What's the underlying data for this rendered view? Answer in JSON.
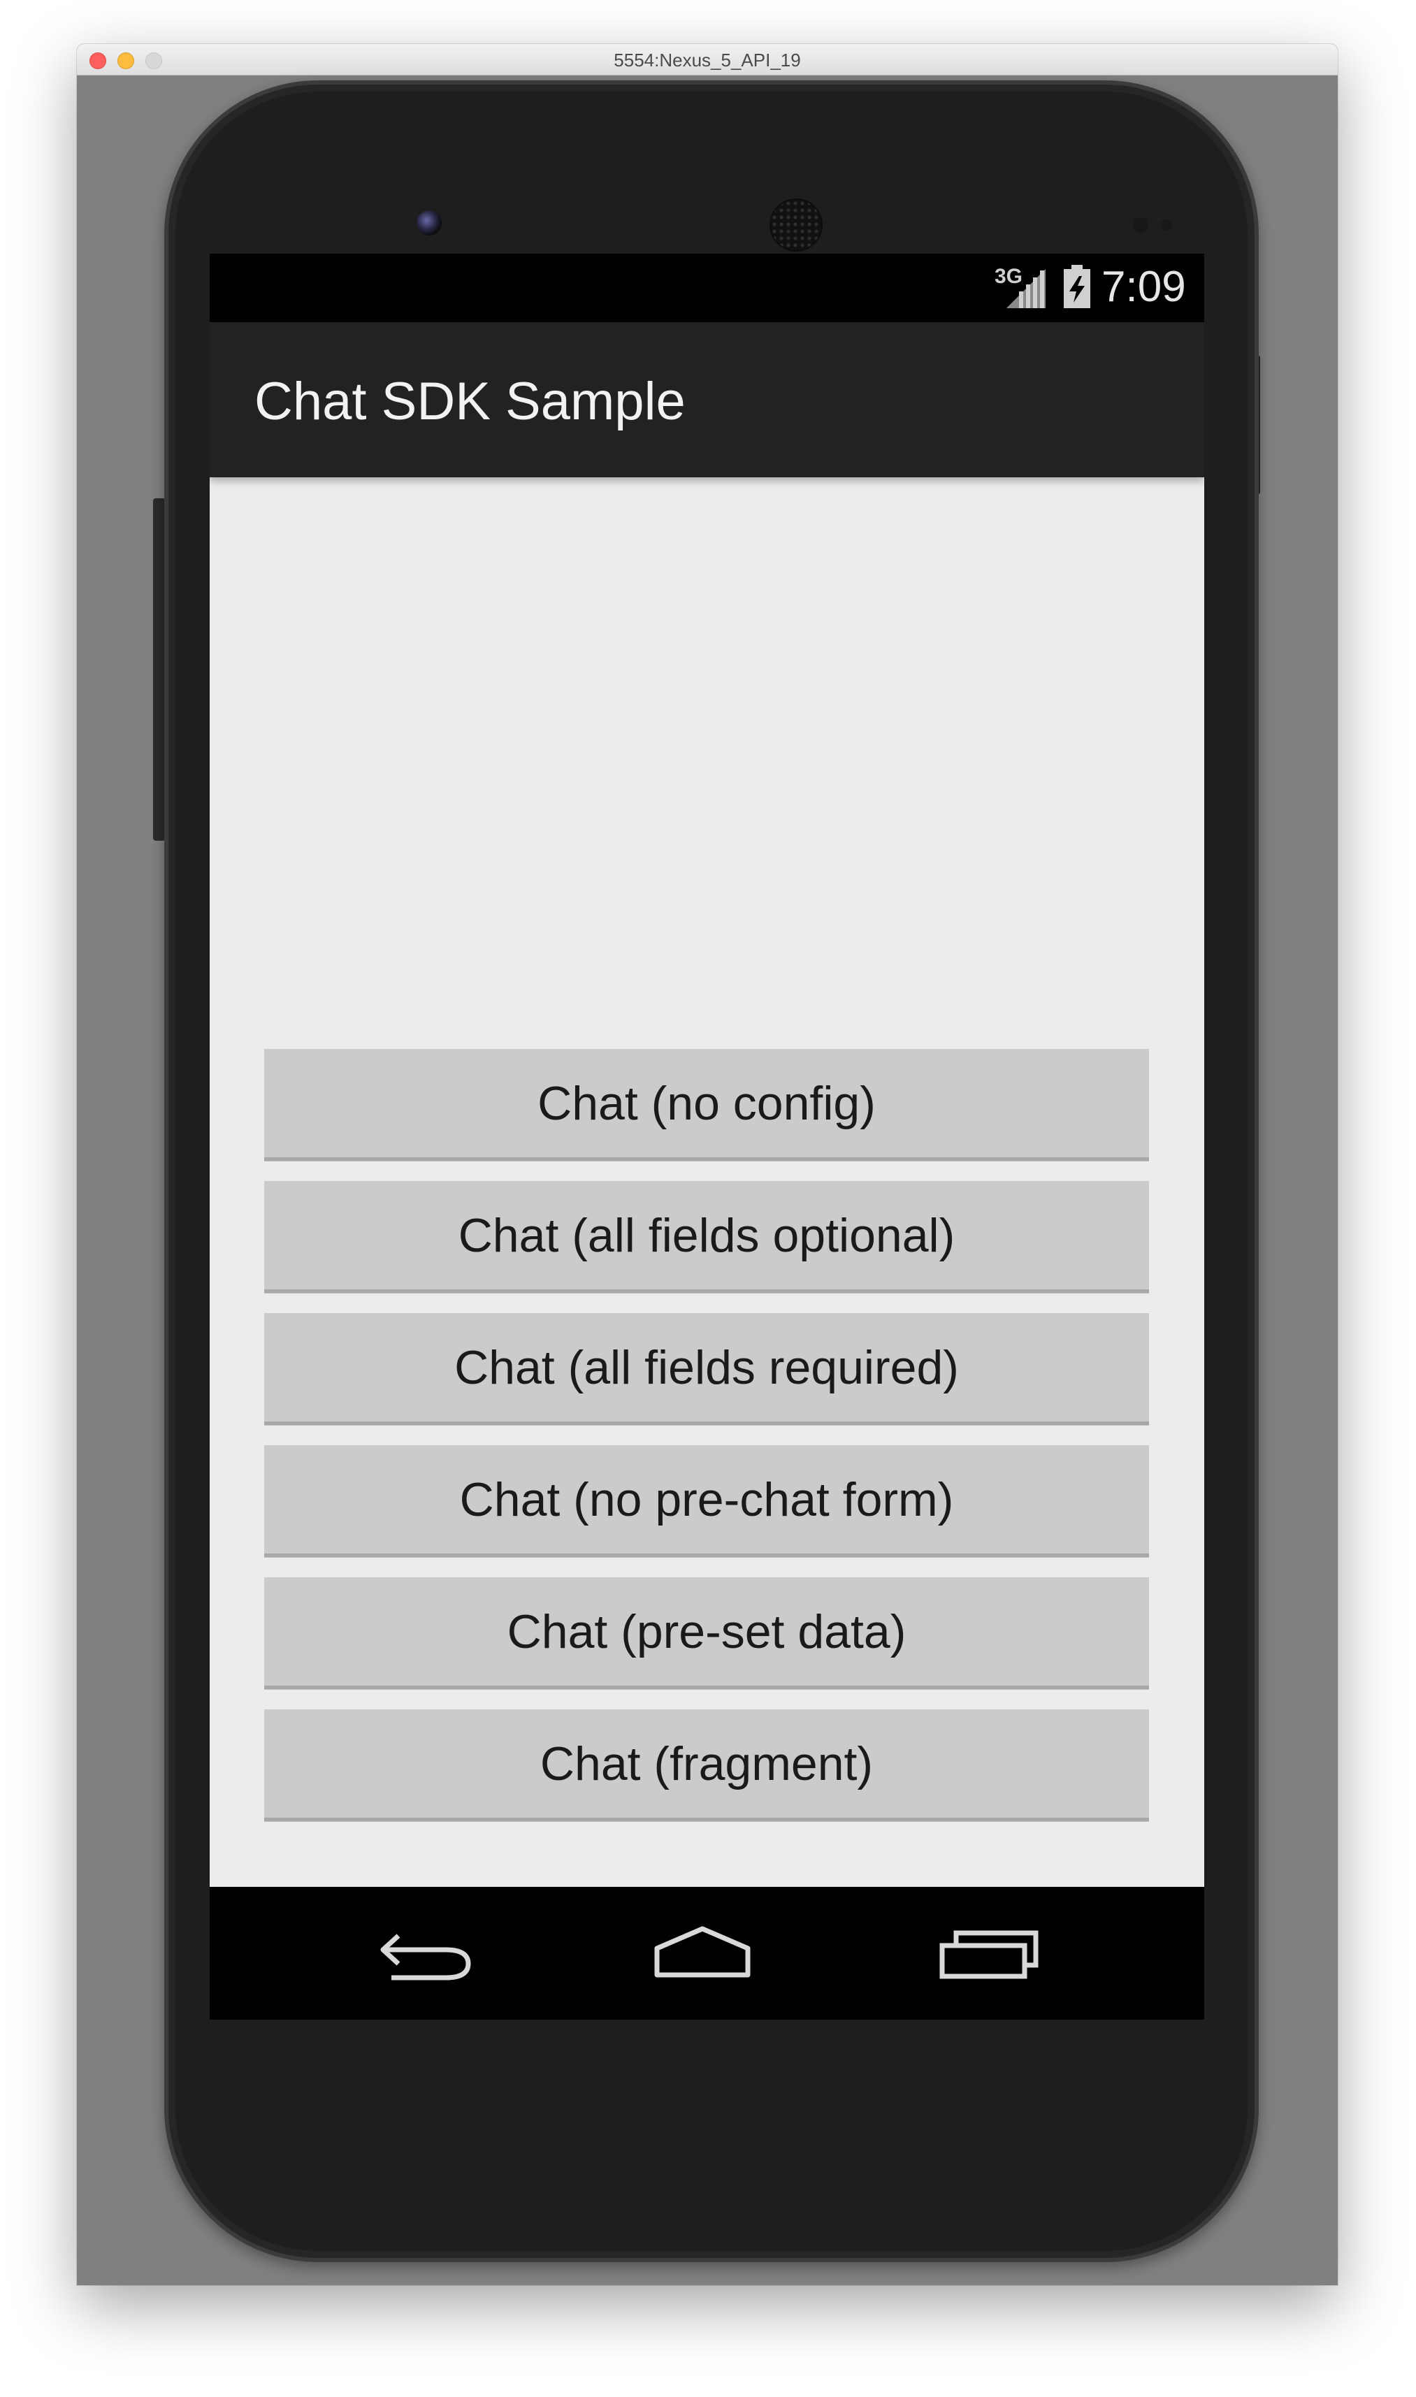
{
  "window": {
    "title": "5554:Nexus_5_API_19"
  },
  "status_bar": {
    "network": "3G",
    "time": "7:09",
    "icons": [
      "signal-icon",
      "battery-icon"
    ]
  },
  "action_bar": {
    "title": "Chat SDK Sample"
  },
  "buttons": [
    {
      "label": "Chat (no config)"
    },
    {
      "label": "Chat (all fields optional)"
    },
    {
      "label": "Chat (all fields required)"
    },
    {
      "label": "Chat (no pre-chat form)"
    },
    {
      "label": "Chat (pre-set data)"
    },
    {
      "label": "Chat (fragment)"
    }
  ],
  "nav_bar": {
    "icons": [
      "back-icon",
      "home-icon",
      "recents-icon"
    ]
  },
  "colors": {
    "action_bar": "#222222",
    "screen_background": "#ececec",
    "button_background": "#cbcbcb",
    "status_bar": "#000000"
  }
}
